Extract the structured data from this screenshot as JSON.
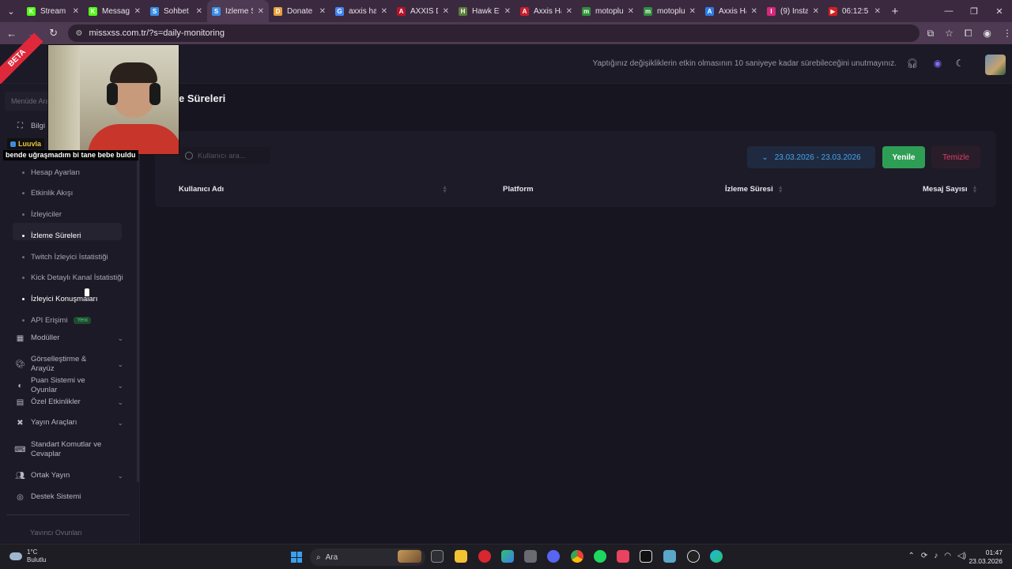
{
  "browser": {
    "tabs": [
      {
        "label": "Stream -",
        "color": "#53fc18",
        "glyph": "K",
        "active": false
      },
      {
        "label": "Message",
        "color": "#53fc18",
        "glyph": "K",
        "active": false
      },
      {
        "label": "Sohbet",
        "color": "#3a8ee6",
        "glyph": "S",
        "active": false
      },
      {
        "label": "İzleme S",
        "color": "#3a8ee6",
        "glyph": "S",
        "active": true
      },
      {
        "label": "Donate",
        "color": "#e8a13b",
        "glyph": "D",
        "active": false
      },
      {
        "label": "axxis hav",
        "color": "#4285f4",
        "glyph": "G",
        "active": false
      },
      {
        "label": "AXXIS D",
        "color": "#b8122a",
        "glyph": "A",
        "active": false
      },
      {
        "label": "Hawk Ev",
        "color": "#5a7d3a",
        "glyph": "H",
        "active": false
      },
      {
        "label": "Axxis Ha",
        "color": "#c91d2d",
        "glyph": "A",
        "active": false
      },
      {
        "label": "motoplu",
        "color": "#2f8f3a",
        "glyph": "m",
        "active": false
      },
      {
        "label": "motoplu",
        "color": "#2f8f3a",
        "glyph": "m",
        "active": false
      },
      {
        "label": "Axxis Ha",
        "color": "#2c7be5",
        "glyph": "A",
        "active": false
      },
      {
        "label": "(9) Insta",
        "color": "#d6287a",
        "glyph": "I",
        "active": false
      },
      {
        "label": "06:12:5",
        "color": "#d61f1f",
        "glyph": "▶",
        "active": false
      }
    ],
    "url": "missxss.com.tr/?s=daily-monitoring"
  },
  "header": {
    "beta_label": "BETA",
    "notice": "Yaptığınız değişikliklerin etkin olmasının 10 saniyeye kadar sürebileceğini unutmayınız."
  },
  "overlay": {
    "chip_label": "Luuvla",
    "caption": "bende uğraşmadım bi tane bebe buldu"
  },
  "sidebar": {
    "search_placeholder": "Menüde Ara",
    "info_label": "Bilgi &",
    "sub_items": [
      {
        "label": "Hesap Ayarları",
        "active": false,
        "bright": false
      },
      {
        "label": "Etkinlik Akışı",
        "active": false,
        "bright": false
      },
      {
        "label": "İzleyiciler",
        "active": false,
        "bright": false
      },
      {
        "label": "İzleme Süreleri",
        "active": true,
        "bright": true
      },
      {
        "label": "Twitch İzleyici İstatistiği",
        "active": false,
        "bright": false
      },
      {
        "label": "Kick Detaylı Kanal İstatistiği",
        "active": false,
        "bright": false
      },
      {
        "label": "İzleyici Konuşmaları",
        "active": false,
        "bright": true
      },
      {
        "label": "API Erişimi",
        "active": false,
        "bright": false,
        "badge": "Yeni"
      }
    ],
    "groups": [
      {
        "label": "Modüller",
        "icon": "grid-icon",
        "chevron": true
      },
      {
        "label": "Görselleştirme & Arayüz",
        "icon": "palette-icon",
        "chevron": true
      },
      {
        "label": "Puan Sistemi ve Oyunlar",
        "icon": "coins-icon",
        "chevron": true
      },
      {
        "label": "Özel Etkinlikler",
        "icon": "calendar-icon",
        "chevron": true
      },
      {
        "label": "Yayın Araçları",
        "icon": "tools-icon",
        "chevron": true
      },
      {
        "label": "Standart Komutlar ve Cevaplar",
        "icon": "keyboard-icon",
        "chevron": false
      },
      {
        "label": "Ortak Yayın",
        "icon": "users-icon",
        "chevron": true
      },
      {
        "label": "Destek Sistemi",
        "icon": "support-icon",
        "chevron": false
      }
    ],
    "cutoff_label": "Yayıncı Oyunları"
  },
  "main": {
    "title": "e Süreleri",
    "search_placeholder": "Kullanıcı ara...",
    "date_range": "23.03.2026 - 23.03.2026",
    "refresh_label": "Yenile",
    "clear_label": "Temizle",
    "columns": [
      "Kullanıcı Adı",
      "Platform",
      "İzleme Süresi",
      "Mesaj Sayısı"
    ]
  },
  "taskbar": {
    "temperature": "1°C",
    "weather": "Bulutlu",
    "search_label": "Ara",
    "time": "01:47",
    "date": "23.03.2026"
  }
}
